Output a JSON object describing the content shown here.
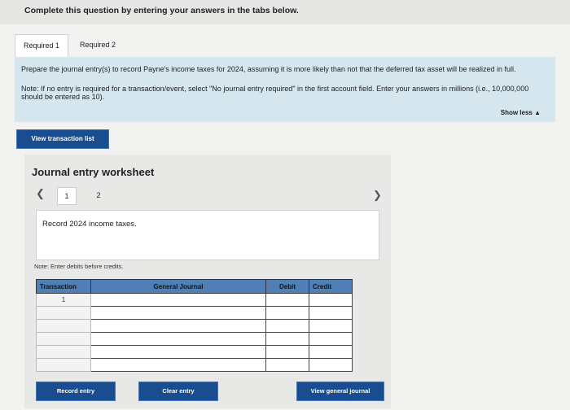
{
  "header": {
    "instruction": "Complete this question by entering your answers in the tabs below."
  },
  "tabs": [
    {
      "label": "Required 1",
      "active": true
    },
    {
      "label": "Required 2",
      "active": false
    }
  ],
  "instructions": {
    "main": "Prepare the journal entry(s) to record Payne's income taxes for 2024, assuming it is more likely than not that the deferred tax asset will be realized in full.",
    "note": "Note: If no entry is required for a transaction/event, select \"No journal entry required\" in the first account field. Enter your answers in millions (i.e., 10,000,000 should be entered as 10).",
    "show_less": "Show less ▲"
  },
  "buttons": {
    "view_transaction_list": "View transaction list",
    "record_entry": "Record entry",
    "clear_entry": "Clear entry",
    "view_general_journal": "View general journal"
  },
  "worksheet": {
    "title": "Journal entry worksheet",
    "pages": [
      "1",
      "2"
    ],
    "current_page": "1",
    "entry_description": "Record 2024 income taxes.",
    "note": "Note: Enter debits before credits."
  },
  "table": {
    "headers": [
      "Transaction",
      "General Journal",
      "Debit",
      "Credit"
    ],
    "rows": [
      {
        "transaction": "1",
        "account": "",
        "debit": "",
        "credit": ""
      },
      {
        "transaction": "",
        "account": "",
        "debit": "",
        "credit": ""
      },
      {
        "transaction": "",
        "account": "",
        "debit": "",
        "credit": ""
      },
      {
        "transaction": "",
        "account": "",
        "debit": "",
        "credit": ""
      },
      {
        "transaction": "",
        "account": "",
        "debit": "",
        "credit": ""
      },
      {
        "transaction": "",
        "account": "",
        "debit": "",
        "credit": ""
      }
    ]
  },
  "colors": {
    "button_bg": "#1a4d8f",
    "table_header": "#4e7fb6",
    "instruction_bg": "#d5e6ee"
  }
}
